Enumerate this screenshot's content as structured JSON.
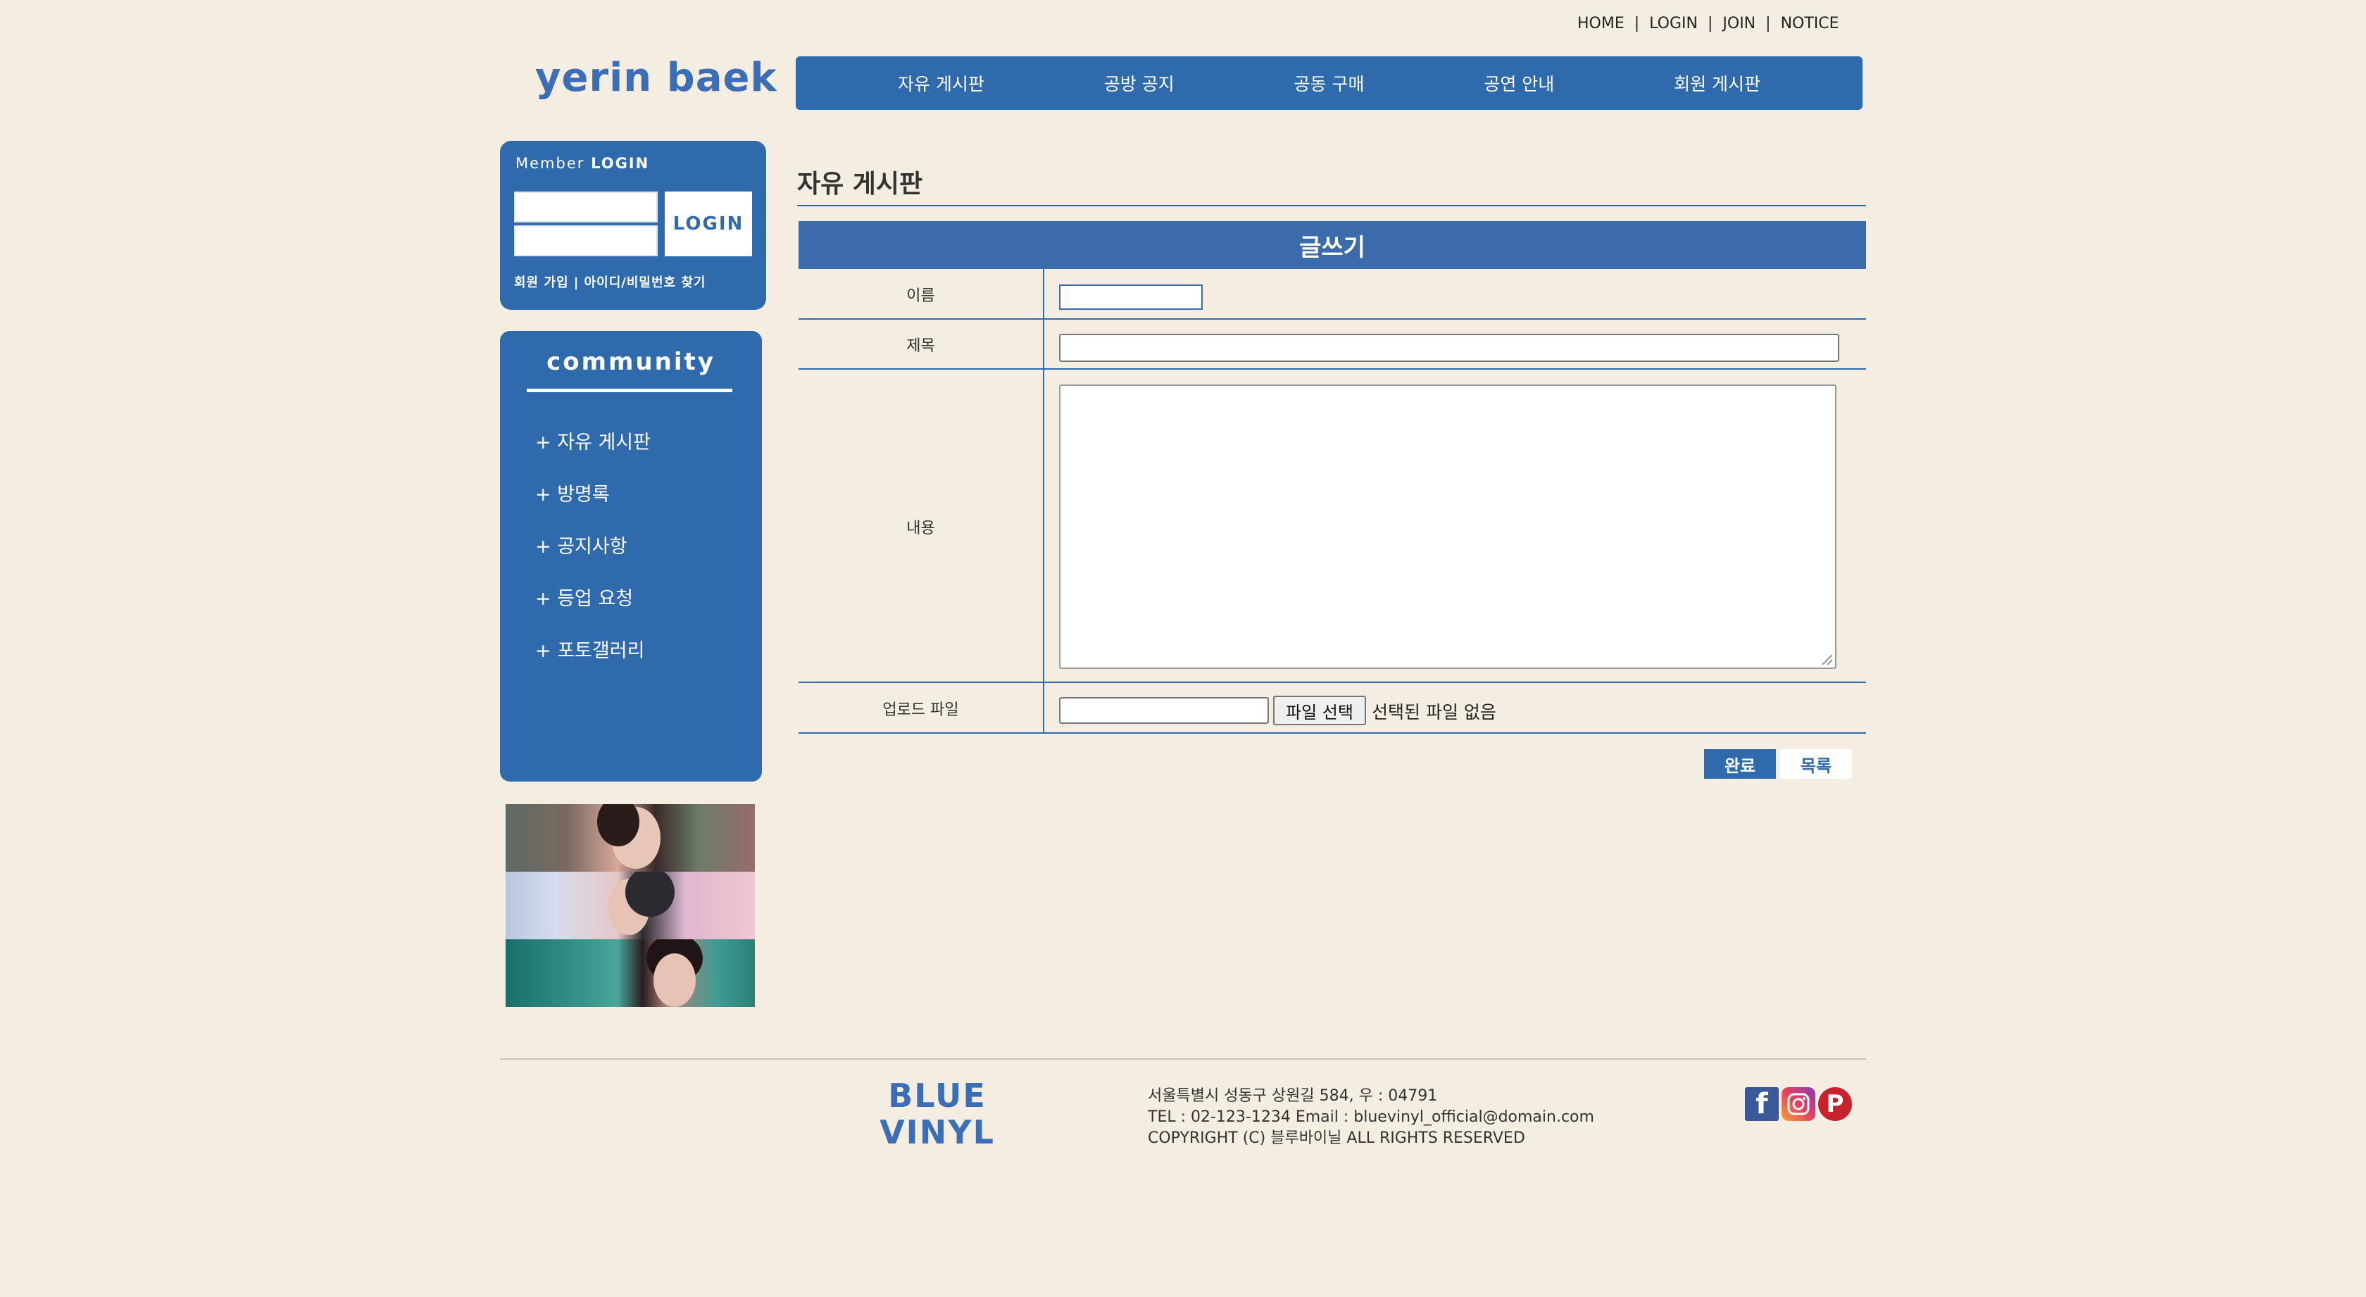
{
  "top_links": [
    "HOME",
    "LOGIN",
    "JOIN",
    "NOTICE"
  ],
  "top_sep": "|",
  "logo": "yerin baek",
  "nav": [
    "자유 게시판",
    "공방 공지",
    "공동 구매",
    "공연 안내",
    "회원 게시판"
  ],
  "login": {
    "title_prefix": "Member",
    "title_strong": "LOGIN",
    "button": "LOGIN",
    "links": "회원 가입  |  아이디/비밀번호 찾기"
  },
  "community": {
    "title": "community",
    "items": [
      "+ 자유 게시판",
      "+ 방명록",
      "+ 공지사항",
      "+ 등업 요청",
      "+ 포토갤러리"
    ]
  },
  "board": {
    "title": "자유 게시판",
    "form_header": "글쓰기",
    "labels": {
      "name": "이름",
      "subject": "제목",
      "content": "내용",
      "upload": "업로드 파일"
    },
    "file_button": "파일 선택",
    "file_status": "선택된 파일 없음",
    "done_button": "완료",
    "list_button": "목록"
  },
  "footer": {
    "logo_line1": "BLUE",
    "logo_line2": "VINYL",
    "address": "서울특별시 성동구 상원길 584, 우 : 04791",
    "contact": "TEL : 02-123-1234 Email : bluevinyl_official@domain.com",
    "copyright": "COPYRIGHT (C) 블루바이닐 ALL RIGHTS RESERVED"
  },
  "colors": {
    "background": "#f3ede2",
    "accent": "#2f6aad"
  },
  "icons": [
    "facebook-icon",
    "instagram-icon",
    "pinterest-icon"
  ]
}
